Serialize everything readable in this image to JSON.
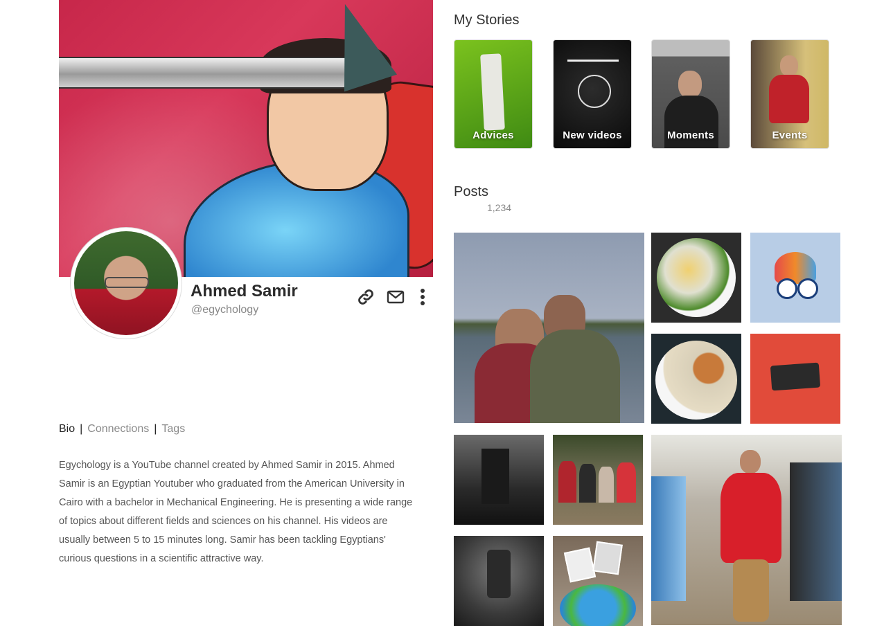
{
  "profile": {
    "name": "Ahmed Samir",
    "handle": "@egychology"
  },
  "actions": {
    "link_icon": "link-icon",
    "mail_icon": "envelope-icon",
    "more_icon": "more-vertical-icon"
  },
  "tabs": {
    "bio": "Bio",
    "connections": "Connections",
    "tags": "Tags",
    "separator": "|"
  },
  "bio": "Egychology is a YouTube channel created by Ahmed Samir in 2015. Ahmed Samir is an Egyptian Youtuber who graduated from the American University in Cairo with a bachelor in Mechanical Engineering. He is presenting a wide range of topics about different fields and sciences on his channel. His videos are usually between 5 to 15 minutes long. Samir has been tackling Egyptians' curious questions in a scientific attractive way.",
  "stories": {
    "title": "My Stories",
    "items": [
      {
        "label": "Advices",
        "color": "#4c9a1b"
      },
      {
        "label": "New videos",
        "color": "#121212"
      },
      {
        "label": "Moments",
        "color": "#6b6b6b"
      },
      {
        "label": "Events",
        "color": "#8a6a2a"
      }
    ]
  },
  "posts": {
    "title": "Posts",
    "count": "1,234"
  },
  "brand_colors": {
    "accent_red": "#c92a2a",
    "text_muted": "#888888"
  }
}
